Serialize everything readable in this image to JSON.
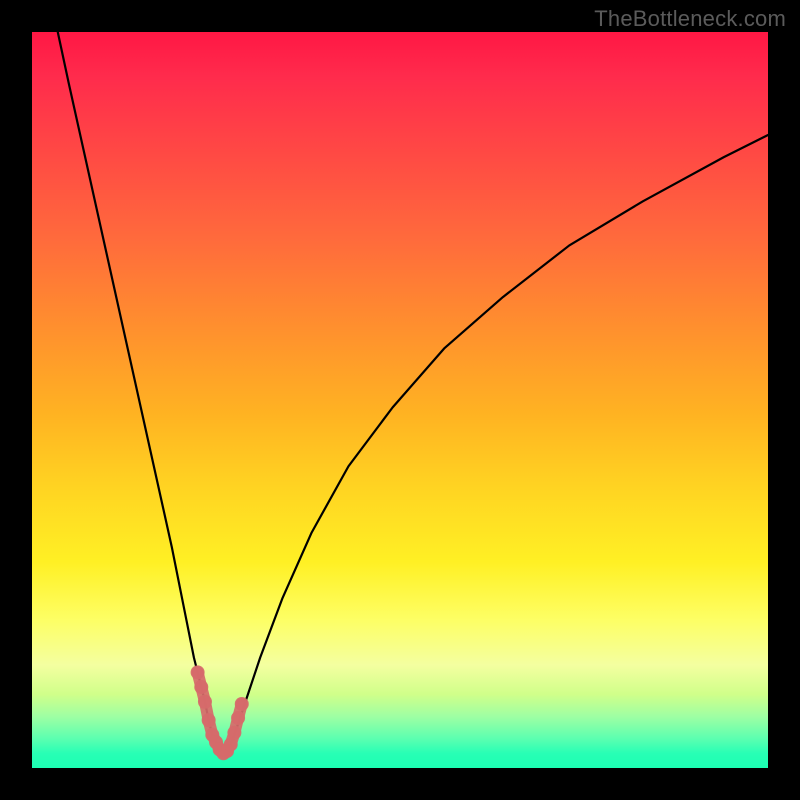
{
  "attribution": "TheBottleneck.com",
  "colors": {
    "curve_stroke": "#000000",
    "marker_stroke": "#d66a6a",
    "gradient_top": "#ff1744",
    "gradient_bottom": "#1cffb3"
  },
  "chart_data": {
    "type": "line",
    "title": "",
    "xlabel": "",
    "ylabel": "",
    "xlim": [
      0,
      100
    ],
    "ylim": [
      0,
      100
    ],
    "series": [
      {
        "name": "bottleneck-curve",
        "x": [
          3.5,
          5,
          7,
          9,
          11,
          13,
          15,
          17,
          19,
          21,
          22,
          23,
          23.5,
          24,
          24.5,
          25,
          25.5,
          26,
          26.5,
          27,
          28,
          29,
          31,
          34,
          38,
          43,
          49,
          56,
          64,
          73,
          83,
          94,
          100
        ],
        "y": [
          100,
          93,
          84,
          75,
          66,
          57,
          48,
          39,
          30,
          20,
          15,
          11,
          9,
          6.5,
          4.5,
          3.5,
          2.5,
          2.0,
          2.3,
          3.2,
          6,
          9,
          15,
          23,
          32,
          41,
          49,
          57,
          64,
          71,
          77,
          83,
          86
        ]
      }
    ],
    "markers": {
      "name": "near-minimum-highlight",
      "x": [
        22.5,
        23,
        23.5,
        24,
        24.5,
        25,
        25.5,
        26,
        26.5,
        27,
        27.5,
        28,
        28.5
      ],
      "y": [
        13,
        11,
        9,
        6.5,
        4.5,
        3.5,
        2.5,
        2.0,
        2.3,
        3.2,
        4.8,
        6.8,
        8.7
      ]
    }
  }
}
